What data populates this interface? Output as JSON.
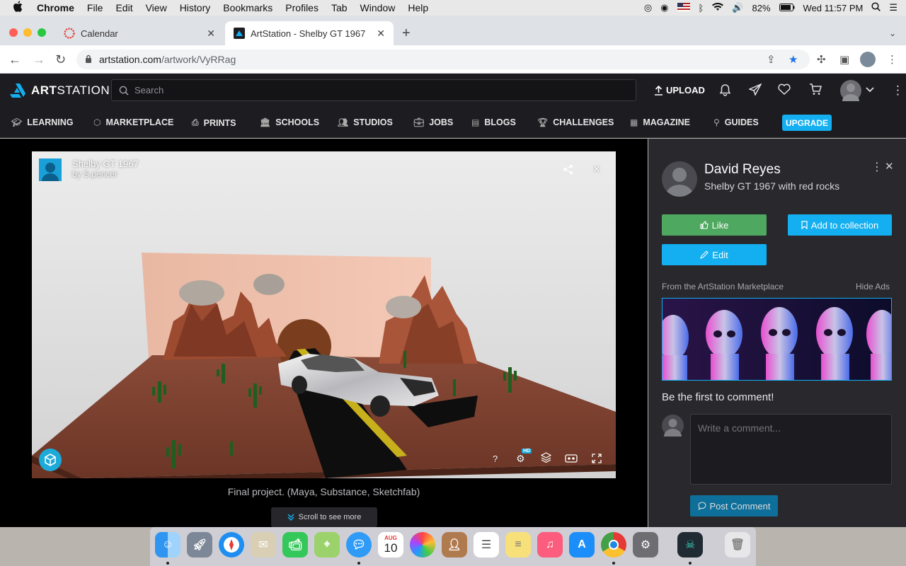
{
  "menubar": {
    "app": "Chrome",
    "items": [
      "File",
      "Edit",
      "View",
      "History",
      "Bookmarks",
      "Profiles",
      "Tab",
      "Window",
      "Help"
    ],
    "battery": "82%",
    "clock": "Wed 11:57 PM"
  },
  "tabs": [
    {
      "title": "Calendar"
    },
    {
      "title": "ArtStation - Shelby GT 1967"
    }
  ],
  "address": {
    "host": "artstation.com",
    "path": "/artwork/VyRRag"
  },
  "header": {
    "logo_a": "ART",
    "logo_b": "STATION",
    "search_placeholder": "Search",
    "upload_label": "UPLOAD"
  },
  "nav": {
    "items": [
      "LEARNING",
      "MARKETPLACE",
      "PRINTS",
      "SCHOOLS",
      "STUDIOS",
      "JOBS",
      "BLOGS",
      "CHALLENGES",
      "MAGAZINE",
      "GUIDES"
    ],
    "upgrade": "UPGRADE"
  },
  "viewer": {
    "title": "Shelby GT 1967",
    "by": "by S.pencer",
    "hd": "HD",
    "help": "?",
    "caption": "Final project. (Maya, Substance, Sketchfab)",
    "scroll_more": "Scroll to see more"
  },
  "sidebar": {
    "author": "David Reyes",
    "artwork_title": "Shelby GT 1967 with red rocks",
    "like": "Like",
    "add_to_collection": "Add to collection",
    "edit": "Edit",
    "marketplace_label": "From the ArtStation Marketplace",
    "hide_ads": "Hide Ads",
    "first_comment": "Be the first to comment!",
    "comment_placeholder": "Write a comment...",
    "post_comment": "Post Comment"
  },
  "dock": {
    "calendar_month": "AUG",
    "calendar_day": "10"
  },
  "colors": {
    "accent": "#13aff0",
    "like_green": "#4fa85f",
    "header_bg": "#1d1d21",
    "sidebar_bg": "#28282d"
  }
}
